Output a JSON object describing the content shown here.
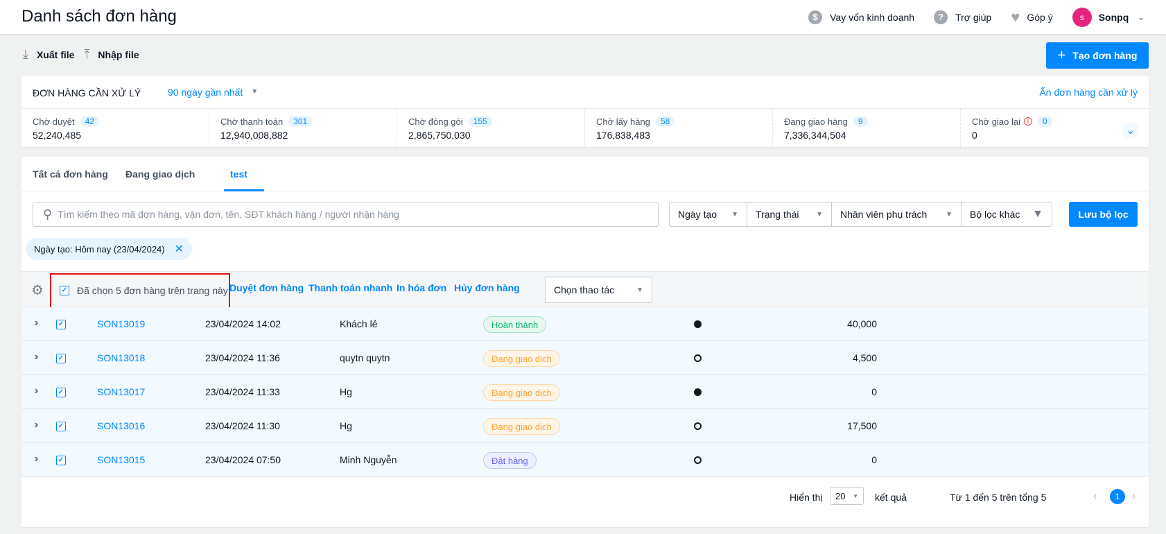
{
  "header": {
    "title": "Danh sách đơn hàng",
    "loan": "Vay vốn kinh doanh",
    "help": "Trợ giúp",
    "feedback": "Góp ý",
    "avatar_initial": "s",
    "user": "Sonpq"
  },
  "toolbar": {
    "export": "Xuất file",
    "import": "Nhập file",
    "create": "Tạo đơn hàng"
  },
  "pending": {
    "title": "ĐƠN HÀNG CẦN XỬ LÝ",
    "range": "90 ngày gần nhất",
    "hide": "Ẩn đơn hàng cần xử lý",
    "stats": [
      {
        "label": "Chờ duyệt",
        "count": "42",
        "value": "52,240,485"
      },
      {
        "label": "Chờ thanh toán",
        "count": "301",
        "value": "12,940,008,882"
      },
      {
        "label": "Chờ đóng gói",
        "count": "155",
        "value": "2,865,750,030"
      },
      {
        "label": "Chờ lấy hàng",
        "count": "58",
        "value": "176,838,483"
      },
      {
        "label": "Đang giao hàng",
        "count": "9",
        "value": "7,336,344,504"
      },
      {
        "label": "Chờ giao lại",
        "count": "0",
        "value": "0"
      }
    ]
  },
  "tabs": [
    {
      "label": "Tất cả đơn hàng"
    },
    {
      "label": "Đang giao dịch"
    },
    {
      "label": "test"
    }
  ],
  "search": {
    "placeholder": "Tìm kiếm theo mã đơn hàng, vận đơn, tên, SĐT khách hàng / người nhận hàng"
  },
  "filters": {
    "created": "Ngày tạo",
    "status": "Trạng thái",
    "staff": "Nhân viên phụ trách",
    "other": "Bộ lọc khác",
    "save": "Lưu bộ lọc"
  },
  "chip": "Ngày tạo: Hôm nay (23/04/2024)",
  "bulk": {
    "selected_text": "Đã chọn 5 đơn hàng trên trang này",
    "approve": "Duyệt đơn hàng",
    "quick_pay": "Thanh toán nhanh",
    "print": "In hóa đơn",
    "cancel": "Hủy đơn hàng",
    "action_select": "Chọn thao tác"
  },
  "orders": [
    {
      "code": "SON13019",
      "time": "23/04/2024 14:02",
      "customer": "Khách lẻ",
      "status": "Hoàn thành",
      "amount": "40,000"
    },
    {
      "code": "SON13018",
      "time": "23/04/2024 11:36",
      "customer": "quytn quytn",
      "status": "Đang giao dịch",
      "amount": "4,500"
    },
    {
      "code": "SON13017",
      "time": "23/04/2024 11:33",
      "customer": "Hg",
      "status": "Đang giao dịch",
      "amount": "0"
    },
    {
      "code": "SON13016",
      "time": "23/04/2024 11:30",
      "customer": "Hg",
      "status": "Đang giao dịch",
      "amount": "17,500"
    },
    {
      "code": "SON13015",
      "time": "23/04/2024 07:50",
      "customer": "Minh Nguyễn",
      "status": "Đặt hàng",
      "amount": "0"
    }
  ],
  "footer": {
    "show": "Hiển thị",
    "page_size": "20",
    "results": "kết quả",
    "range": "Từ 1 đến 5 trên tổng 5",
    "current_page": "1"
  },
  "colors": {
    "accent": "#0088ff",
    "status_done": "#0db473",
    "status_trading": "#ffa233",
    "status_ordered": "#6366f1",
    "highlight_box": "#e3140f"
  },
  "icons": [
    "dollar-icon",
    "help-icon",
    "heart-icon",
    "chevron-down-icon",
    "download-icon",
    "upload-icon",
    "plus-icon",
    "search-icon",
    "filter-icon",
    "close-icon",
    "gear-icon",
    "checkbox-icon",
    "double-chevron-right-icon",
    "chevron-left-icon",
    "chevron-right-icon"
  ]
}
